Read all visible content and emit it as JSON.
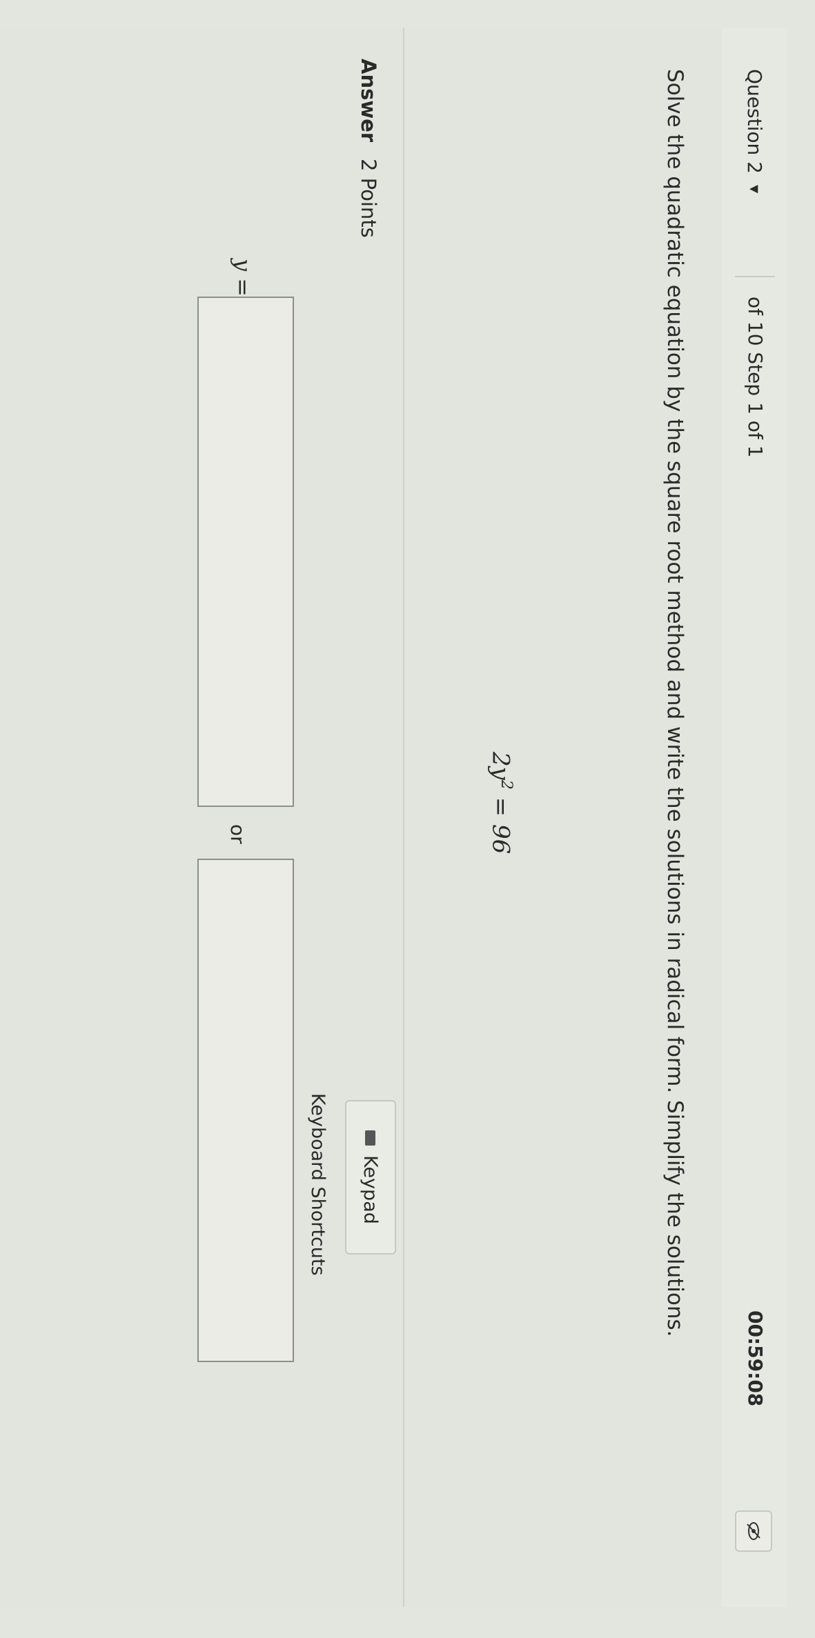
{
  "header": {
    "question_label": "Question 2",
    "step_text": "of 10 Step 1 of 1",
    "timer": "00:59:08"
  },
  "question": {
    "prompt": "Solve the quadratic equation by the square root method and write the solutions in radical form. Simplify the solutions.",
    "equation_lhs": "2y",
    "equation_exp": "2",
    "equation_rhs": " = 96"
  },
  "answer": {
    "label": "Answer",
    "points": "2 Points",
    "keypad_label": "Keypad",
    "shortcuts_label": "Keyboard Shortcuts",
    "variable_label": "y =",
    "or_label": "or",
    "box1_value": "",
    "box2_value": ""
  }
}
